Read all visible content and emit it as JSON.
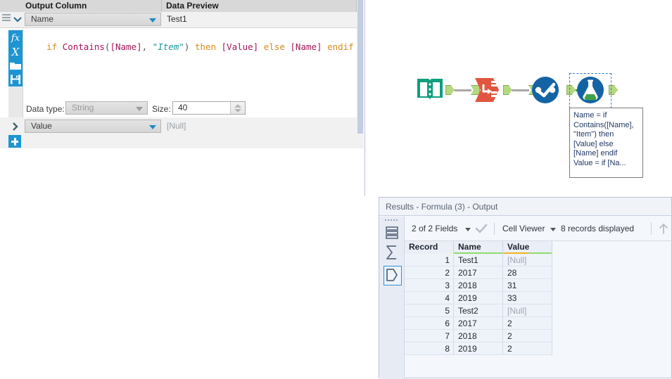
{
  "config": {
    "columns": [
      {
        "label": "Output Column"
      },
      {
        "label": "Data Preview"
      }
    ],
    "rows": [
      {
        "output_column": "Name",
        "data_preview": "Test1",
        "expanded": true,
        "formula": {
          "tokens": [
            {
              "t": "if",
              "c": "k-kw"
            },
            {
              "t": " ",
              "c": "k-pl"
            },
            {
              "t": "Contains",
              "c": "k-fn"
            },
            {
              "t": "(",
              "c": "k-pl"
            },
            {
              "t": "[Name]",
              "c": "k-fld"
            },
            {
              "t": ", ",
              "c": "k-pl"
            },
            {
              "t": "\"Item\"",
              "c": "k-str"
            },
            {
              "t": ")",
              "c": "k-pl"
            },
            {
              "t": " ",
              "c": "k-pl"
            },
            {
              "t": "then",
              "c": "k-kw"
            },
            {
              "t": " ",
              "c": "k-pl"
            },
            {
              "t": "[Value]",
              "c": "k-fld"
            },
            {
              "t": " ",
              "c": "k-pl"
            },
            {
              "t": "else",
              "c": "k-kw"
            },
            {
              "t": " ",
              "c": "k-pl"
            },
            {
              "t": "[Name]",
              "c": "k-fld"
            },
            {
              "t": " ",
              "c": "k-pl"
            },
            {
              "t": "endif",
              "c": "k-kw"
            }
          ],
          "plain": "if Contains([Name], \"Item\") then [Value] else [Name] endif"
        },
        "datatype_label": "Data type:",
        "datatype_value": "String",
        "size_label": "Size:",
        "size_value": "40"
      },
      {
        "output_column": "Value",
        "data_preview": "[Null]",
        "expanded": false
      }
    ],
    "editor_icons": [
      {
        "name": "fx-icon",
        "glyph": "ƒx"
      },
      {
        "name": "xvar-icon",
        "glyph": "𝑋"
      },
      {
        "name": "open-icon",
        "glyph": "📁"
      },
      {
        "name": "save-icon",
        "glyph": "💾"
      }
    ],
    "add_button": "+",
    "delete_icon": "delete-row-icon"
  },
  "canvas": {
    "tools": [
      {
        "name": "input-data-tool",
        "title": "Input Data"
      },
      {
        "name": "transpose-tool",
        "title": "Transpose"
      },
      {
        "name": "select-tool",
        "title": "Select"
      },
      {
        "name": "formula-tool",
        "title": "Formula",
        "selected": true
      }
    ],
    "annotation": {
      "lines": [
        "Name = if",
        "Contains([Name],",
        "\"Item\") then",
        "[Value] else",
        "[Name] endif",
        "Value = if [Na..."
      ]
    },
    "connector_active_color": "#3fa24a"
  },
  "results": {
    "title_prefix": "Results",
    "title": "Results - Formula (3) - Output",
    "toolbar": {
      "fields_label": "2 of 2 Fields",
      "cell_viewer_label": "Cell Viewer",
      "records_label": "8 records displayed"
    },
    "rail_icons": [
      {
        "name": "table-view-icon",
        "selected": false
      },
      {
        "name": "summary-sigma-icon",
        "selected": false
      },
      {
        "name": "data-shape-icon",
        "selected": true
      }
    ],
    "table": {
      "headers": [
        "Record",
        "Name",
        "Value"
      ],
      "header_underlines": [
        "",
        "#8ede6d",
        "#f5b426"
      ],
      "rows": [
        {
          "record": "1",
          "name": "Test1",
          "value": "[Null]",
          "null": true
        },
        {
          "record": "2",
          "name": "2017",
          "value": "28",
          "null": false
        },
        {
          "record": "3",
          "name": "2018",
          "value": "31",
          "null": false
        },
        {
          "record": "4",
          "name": "2019",
          "value": "33",
          "null": false
        },
        {
          "record": "5",
          "name": "Test2",
          "value": "[Null]",
          "null": true
        },
        {
          "record": "6",
          "name": "2017",
          "value": "2",
          "null": false
        },
        {
          "record": "7",
          "name": "2018",
          "value": "2",
          "null": false
        },
        {
          "record": "8",
          "name": "2019",
          "value": "2",
          "null": false
        }
      ]
    }
  }
}
